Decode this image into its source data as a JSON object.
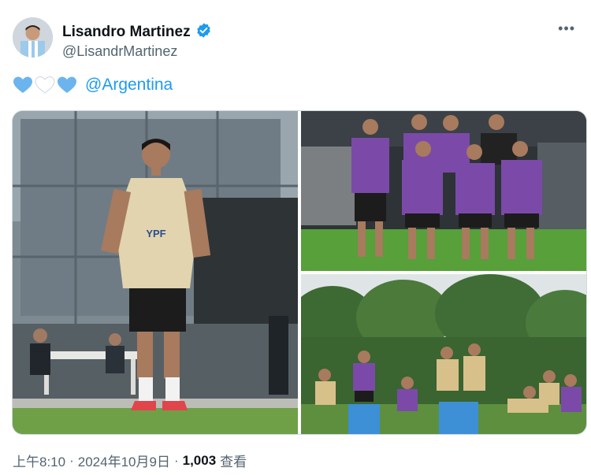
{
  "profile": {
    "display_name": "Lisandro Martinez",
    "handle": "@LisandrMartinez",
    "verified_icon": "verified-badge-icon",
    "colors": {
      "verified": "#1d9bf0"
    }
  },
  "tweet": {
    "hearts": [
      {
        "icon": "blue-heart-icon",
        "color": "#6cb4ee"
      },
      {
        "icon": "white-heart-icon",
        "color": "#ffffff"
      },
      {
        "icon": "blue-heart-icon",
        "color": "#6cb4ee"
      }
    ],
    "mention": "@Argentina"
  },
  "media": {
    "photos": [
      {
        "name": "photo-player-walking",
        "jersey_text": "YPF"
      },
      {
        "name": "photo-team-group"
      },
      {
        "name": "photo-team-seated"
      }
    ]
  },
  "footer": {
    "time": "上午8:10",
    "sep1": "·",
    "date": "2024年10月9日",
    "sep2": "·",
    "views_count": "1,003",
    "views_label": "查看"
  },
  "more_icon": "more-dots-icon"
}
